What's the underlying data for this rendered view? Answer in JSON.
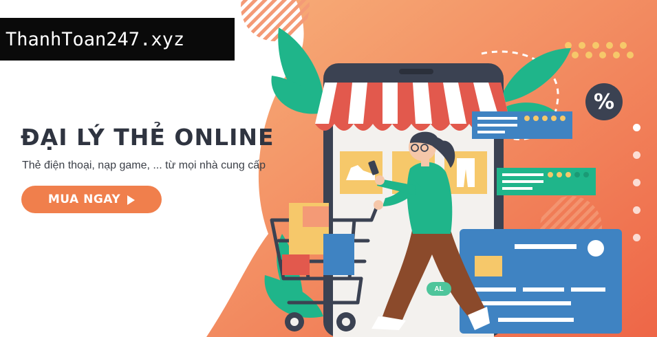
{
  "logo": {
    "text": "ThanhToan247.xyz"
  },
  "hero": {
    "headline": "ĐẠI LÝ THẺ ONLINE",
    "subline": "Thẻ điện thoại, nạp game, ... từ mọi nhà cung cấp",
    "cta_label": "MUA NGAY"
  },
  "illustration": {
    "percent_badge": "%",
    "tag_text": "AL",
    "rating_cards": [
      {
        "stars": 5
      },
      {
        "stars": 3
      }
    ]
  },
  "carousel": {
    "slide_count": 5,
    "active_index": 0
  },
  "colors": {
    "accent": "#f07f4c",
    "background_gradient_start": "#f5a26f",
    "background_gradient_end": "#ef6b4a",
    "headline": "#2f3440",
    "green": "#1fb58a",
    "navy": "#3b4252"
  }
}
